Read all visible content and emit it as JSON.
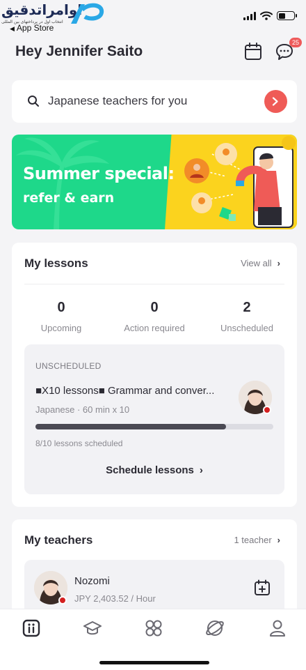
{
  "status_bar": {
    "logo_text": "اوامراتدقیق",
    "logo_sub": "انتخاب اول در پرداختهای بین المللی",
    "back_label": "App Store"
  },
  "header": {
    "greeting": "Hey Jennifer Saito",
    "chat_badge": "25",
    "calendar_icon": "calendar-icon",
    "chat_icon": "chat-icon"
  },
  "search": {
    "placeholder": "Japanese teachers for you"
  },
  "banner": {
    "title": "Summer special:",
    "subtitle": "refer & earn",
    "colors": {
      "left": "#1ed88a",
      "right": "#fbd31e"
    }
  },
  "lessons": {
    "title": "My lessons",
    "view_all": "View all",
    "stats": [
      {
        "value": "0",
        "label": "Upcoming"
      },
      {
        "value": "0",
        "label": "Action required"
      },
      {
        "value": "2",
        "label": "Unscheduled"
      }
    ],
    "unscheduled": {
      "heading": "UNSCHEDULED",
      "course_title": "■X10 lessons■ Grammar and conver...",
      "course_meta": "Japanese · 60 min x 10",
      "progress_fraction": 0.8,
      "progress_label": "8/10 lessons scheduled",
      "action": "Schedule lessons"
    }
  },
  "teachers": {
    "title": "My teachers",
    "count_link": "1 teacher",
    "items": [
      {
        "name": "Nozomi",
        "price": "JPY 2,403.52 / Hour"
      }
    ]
  },
  "tabbar": {
    "tabs": [
      "home-icon",
      "lessons-icon",
      "apps-icon",
      "community-icon",
      "profile-icon"
    ]
  },
  "accent_color": "#ef5b57"
}
